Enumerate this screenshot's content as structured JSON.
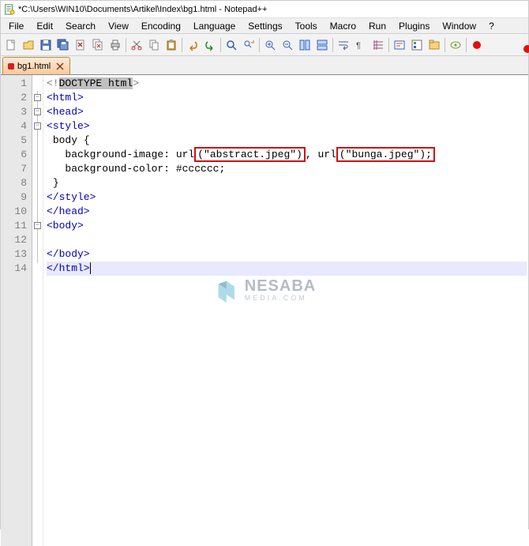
{
  "titlebar": {
    "title": "*C:\\Users\\WIN10\\Documents\\Artikel\\Index\\bg1.html - Notepad++"
  },
  "menubar": {
    "items": [
      "File",
      "Edit",
      "Search",
      "View",
      "Encoding",
      "Language",
      "Settings",
      "Tools",
      "Macro",
      "Run",
      "Plugins",
      "Window",
      "?"
    ]
  },
  "tab": {
    "label": "bg1.html"
  },
  "code": {
    "lines": [
      {
        "n": "1",
        "pre": "",
        "t1": "<!",
        "sel": "DOCTYPE html",
        "t2": ">",
        "cls": "gray"
      },
      {
        "n": "2",
        "pre": "",
        "t": "<html>",
        "cls": "kw",
        "fold": true
      },
      {
        "n": "3",
        "pre": "",
        "t": "<head>",
        "cls": "kw",
        "fold": true
      },
      {
        "n": "4",
        "pre": "",
        "t": "<style>",
        "cls": "kw",
        "fold": true
      },
      {
        "n": "5",
        "pre": " ",
        "t": "body {",
        "cls": ""
      },
      {
        "n": "6",
        "pre": "   ",
        "a": "background-image: url",
        "b": "(\"abstract.jpeg\")",
        "c": ", url",
        "d": "(\"bunga.jpeg\");",
        "cls": ""
      },
      {
        "n": "7",
        "pre": "   ",
        "t": "background-color: #cccccc;",
        "cls": ""
      },
      {
        "n": "8",
        "pre": " ",
        "t": "}",
        "cls": ""
      },
      {
        "n": "9",
        "pre": "",
        "t": "</style>",
        "cls": "kw"
      },
      {
        "n": "10",
        "pre": "",
        "t": "</head>",
        "cls": "kw"
      },
      {
        "n": "11",
        "pre": "",
        "t": "<body>",
        "cls": "kw",
        "fold": true
      },
      {
        "n": "12",
        "pre": "",
        "t": "",
        "cls": ""
      },
      {
        "n": "13",
        "pre": "",
        "t": "</body>",
        "cls": "kw"
      },
      {
        "n": "14",
        "pre": "",
        "t": "</html>",
        "cls": "kw",
        "highlight": true
      }
    ]
  },
  "watermark": {
    "brand": "NESABA",
    "sub": "MEDIA.COM"
  }
}
